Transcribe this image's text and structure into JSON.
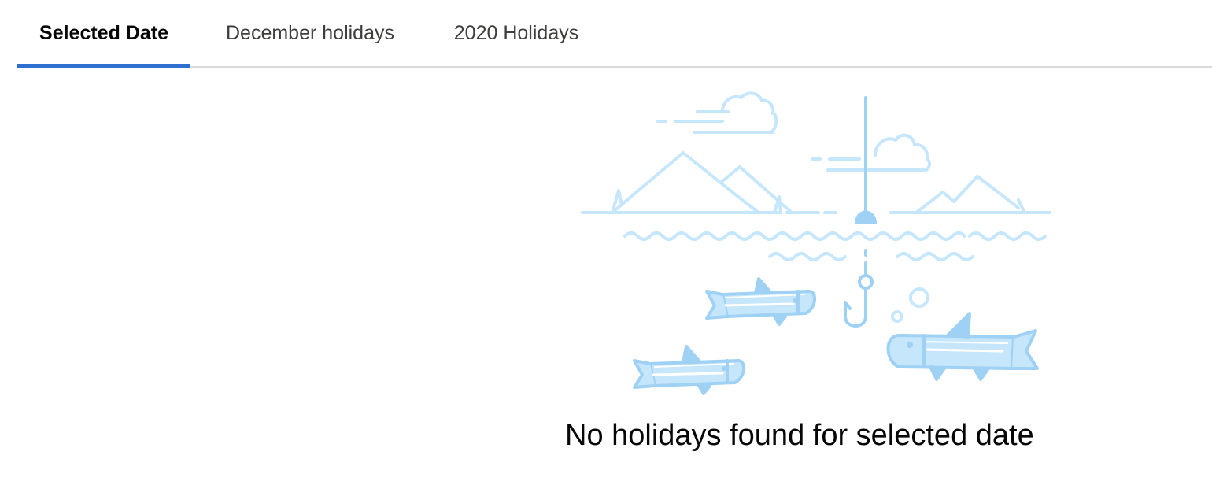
{
  "tabs": [
    {
      "label": "Selected Date",
      "active": true
    },
    {
      "label": "December holidays",
      "active": false
    },
    {
      "label": "2020 Holidays",
      "active": false
    }
  ],
  "empty_state": {
    "illustration_icon": "fishing-scene-icon",
    "message": "No holidays found for selected date"
  },
  "colors": {
    "accent": "#2f6fcf",
    "illustration_light": "#c6e6fb",
    "illustration_mid": "#9fd1f4",
    "divider": "#dddbda"
  }
}
